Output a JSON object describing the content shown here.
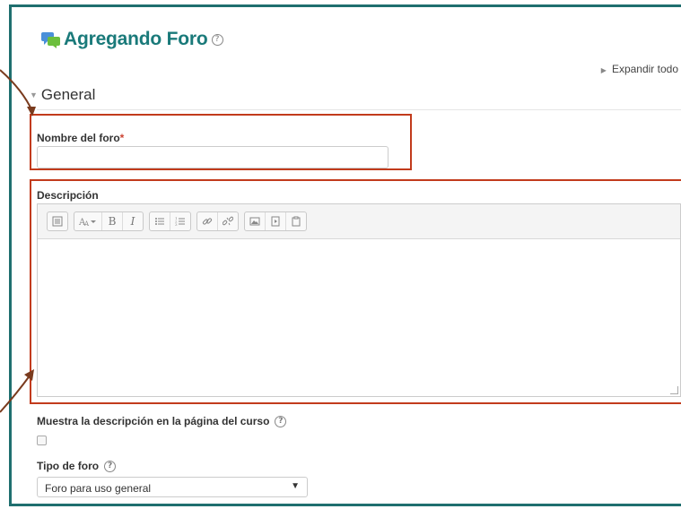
{
  "page": {
    "title": "Agregando Foro",
    "help_glyph": "?",
    "expand_all": "Expandir todo",
    "section": "General"
  },
  "form": {
    "name_label": "Nombre del foro",
    "required_mark": "*",
    "name_value": "",
    "description_label": "Descripción",
    "show_description_label": "Muestra la descripción en la página del curso",
    "show_description_checked": false,
    "forum_type_label": "Tipo de foro",
    "forum_type_value": "Foro para uso general"
  },
  "editor": {
    "toolbar_groups": [
      [
        "collapse-icon"
      ],
      [
        "text-style-icon",
        "bold-icon",
        "italic-icon"
      ],
      [
        "unordered-list-icon",
        "ordered-list-icon"
      ],
      [
        "link-icon",
        "unlink-icon"
      ],
      [
        "image-icon",
        "media-icon",
        "paste-icon"
      ]
    ],
    "bold_glyph": "B",
    "italic_glyph": "I",
    "content": ""
  },
  "colors": {
    "frame": "#1f6f6f",
    "title": "#1a7a7a",
    "highlight": "#c23b1c",
    "required": "#cc4433"
  }
}
